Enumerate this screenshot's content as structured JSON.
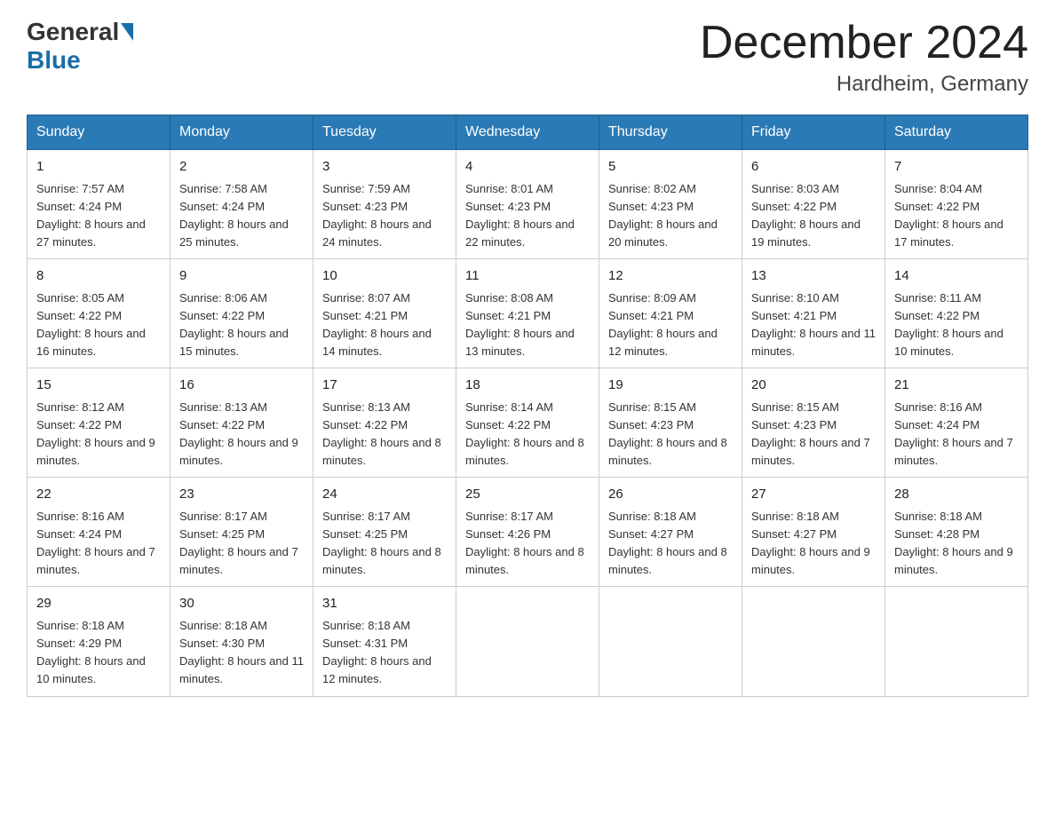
{
  "header": {
    "logo_general": "General",
    "logo_blue": "Blue",
    "month_title": "December 2024",
    "location": "Hardheim, Germany"
  },
  "days_of_week": [
    "Sunday",
    "Monday",
    "Tuesday",
    "Wednesday",
    "Thursday",
    "Friday",
    "Saturday"
  ],
  "weeks": [
    [
      {
        "day": 1,
        "sunrise": "7:57 AM",
        "sunset": "4:24 PM",
        "daylight": "8 hours and 27 minutes."
      },
      {
        "day": 2,
        "sunrise": "7:58 AM",
        "sunset": "4:24 PM",
        "daylight": "8 hours and 25 minutes."
      },
      {
        "day": 3,
        "sunrise": "7:59 AM",
        "sunset": "4:23 PM",
        "daylight": "8 hours and 24 minutes."
      },
      {
        "day": 4,
        "sunrise": "8:01 AM",
        "sunset": "4:23 PM",
        "daylight": "8 hours and 22 minutes."
      },
      {
        "day": 5,
        "sunrise": "8:02 AM",
        "sunset": "4:23 PM",
        "daylight": "8 hours and 20 minutes."
      },
      {
        "day": 6,
        "sunrise": "8:03 AM",
        "sunset": "4:22 PM",
        "daylight": "8 hours and 19 minutes."
      },
      {
        "day": 7,
        "sunrise": "8:04 AM",
        "sunset": "4:22 PM",
        "daylight": "8 hours and 17 minutes."
      }
    ],
    [
      {
        "day": 8,
        "sunrise": "8:05 AM",
        "sunset": "4:22 PM",
        "daylight": "8 hours and 16 minutes."
      },
      {
        "day": 9,
        "sunrise": "8:06 AM",
        "sunset": "4:22 PM",
        "daylight": "8 hours and 15 minutes."
      },
      {
        "day": 10,
        "sunrise": "8:07 AM",
        "sunset": "4:21 PM",
        "daylight": "8 hours and 14 minutes."
      },
      {
        "day": 11,
        "sunrise": "8:08 AM",
        "sunset": "4:21 PM",
        "daylight": "8 hours and 13 minutes."
      },
      {
        "day": 12,
        "sunrise": "8:09 AM",
        "sunset": "4:21 PM",
        "daylight": "8 hours and 12 minutes."
      },
      {
        "day": 13,
        "sunrise": "8:10 AM",
        "sunset": "4:21 PM",
        "daylight": "8 hours and 11 minutes."
      },
      {
        "day": 14,
        "sunrise": "8:11 AM",
        "sunset": "4:22 PM",
        "daylight": "8 hours and 10 minutes."
      }
    ],
    [
      {
        "day": 15,
        "sunrise": "8:12 AM",
        "sunset": "4:22 PM",
        "daylight": "8 hours and 9 minutes."
      },
      {
        "day": 16,
        "sunrise": "8:13 AM",
        "sunset": "4:22 PM",
        "daylight": "8 hours and 9 minutes."
      },
      {
        "day": 17,
        "sunrise": "8:13 AM",
        "sunset": "4:22 PM",
        "daylight": "8 hours and 8 minutes."
      },
      {
        "day": 18,
        "sunrise": "8:14 AM",
        "sunset": "4:22 PM",
        "daylight": "8 hours and 8 minutes."
      },
      {
        "day": 19,
        "sunrise": "8:15 AM",
        "sunset": "4:23 PM",
        "daylight": "8 hours and 8 minutes."
      },
      {
        "day": 20,
        "sunrise": "8:15 AM",
        "sunset": "4:23 PM",
        "daylight": "8 hours and 7 minutes."
      },
      {
        "day": 21,
        "sunrise": "8:16 AM",
        "sunset": "4:24 PM",
        "daylight": "8 hours and 7 minutes."
      }
    ],
    [
      {
        "day": 22,
        "sunrise": "8:16 AM",
        "sunset": "4:24 PM",
        "daylight": "8 hours and 7 minutes."
      },
      {
        "day": 23,
        "sunrise": "8:17 AM",
        "sunset": "4:25 PM",
        "daylight": "8 hours and 7 minutes."
      },
      {
        "day": 24,
        "sunrise": "8:17 AM",
        "sunset": "4:25 PM",
        "daylight": "8 hours and 8 minutes."
      },
      {
        "day": 25,
        "sunrise": "8:17 AM",
        "sunset": "4:26 PM",
        "daylight": "8 hours and 8 minutes."
      },
      {
        "day": 26,
        "sunrise": "8:18 AM",
        "sunset": "4:27 PM",
        "daylight": "8 hours and 8 minutes."
      },
      {
        "day": 27,
        "sunrise": "8:18 AM",
        "sunset": "4:27 PM",
        "daylight": "8 hours and 9 minutes."
      },
      {
        "day": 28,
        "sunrise": "8:18 AM",
        "sunset": "4:28 PM",
        "daylight": "8 hours and 9 minutes."
      }
    ],
    [
      {
        "day": 29,
        "sunrise": "8:18 AM",
        "sunset": "4:29 PM",
        "daylight": "8 hours and 10 minutes."
      },
      {
        "day": 30,
        "sunrise": "8:18 AM",
        "sunset": "4:30 PM",
        "daylight": "8 hours and 11 minutes."
      },
      {
        "day": 31,
        "sunrise": "8:18 AM",
        "sunset": "4:31 PM",
        "daylight": "8 hours and 12 minutes."
      },
      null,
      null,
      null,
      null
    ]
  ]
}
